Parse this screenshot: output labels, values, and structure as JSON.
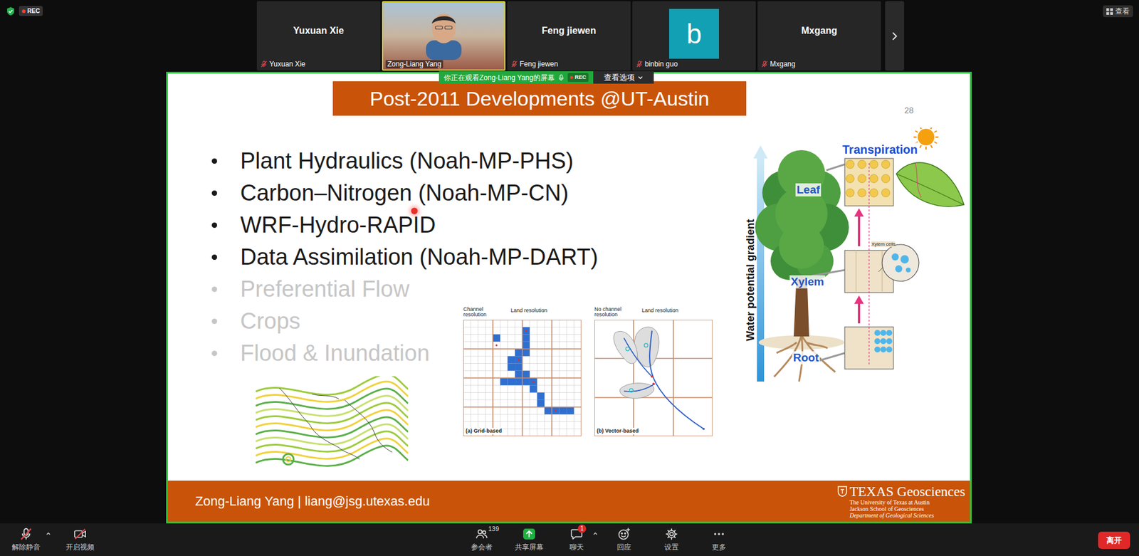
{
  "top_bar": {
    "recording": "REC",
    "view_button": "查看"
  },
  "participants": [
    {
      "kind": "name",
      "title": "Yuxuan Xie",
      "label": "Yuxuan Xie",
      "muted": true,
      "selected": false
    },
    {
      "kind": "video",
      "label": "Zong-Liang Yang",
      "selected": true
    },
    {
      "kind": "name",
      "title": "Feng jiewen",
      "label": "Feng jiewen",
      "muted": true,
      "selected": false
    },
    {
      "kind": "avatar",
      "avatar": "b",
      "label": "binbin guo",
      "muted": true,
      "selected": false
    },
    {
      "kind": "name",
      "title": "Mxgang",
      "label": "Mxgang",
      "muted": true,
      "selected": false
    }
  ],
  "share_banner": {
    "text": "你正在观看Zong-Liang Yang的屏幕",
    "rec": "REC",
    "options": "查看选项"
  },
  "slide": {
    "title": "Post-2011 Developments @UT-Austin",
    "page": "28",
    "bullets": [
      {
        "text": "Plant Hydraulics (Noah-MP-PHS)",
        "dimmed": false
      },
      {
        "text": "Carbon–Nitrogen (Noah-MP-CN)",
        "dimmed": false
      },
      {
        "text": "WRF-Hydro-RAPID",
        "dimmed": false
      },
      {
        "text": "Data Assimilation (Noah-MP-DART)",
        "dimmed": false
      },
      {
        "text": "Preferential Flow",
        "dimmed": true
      },
      {
        "text": "Crops",
        "dimmed": true
      },
      {
        "text": "Flood & Inundation",
        "dimmed": true
      }
    ],
    "grid_figure": {
      "channel_label": "Channel resolution",
      "land_label": "Land resolution",
      "caption": "(a) Grid-based"
    },
    "vector_figure": {
      "channel_label": "No channel resolution",
      "land_label": "Land resolution",
      "caption": "(b) Vector-based"
    },
    "tree_figure": {
      "axis": "Water potential gradient",
      "transpiration": "Transpiration",
      "leaf": "Leaf",
      "xylem": "Xylem",
      "root": "Root",
      "xylem_cells": "Xylem cells"
    },
    "footer": {
      "author_line": "Zong-Liang Yang | liang@jsg.utexas.edu",
      "logo": "TEXAS Geosciences",
      "logo_lines": [
        "The University of Texas at Austin",
        "Jackson School of Geosciences",
        "Department of Geological Sciences"
      ]
    }
  },
  "toolbar": {
    "left": [
      {
        "label": "解除静音",
        "off": true
      },
      {
        "label": "开启视频",
        "off": true
      }
    ],
    "center": [
      {
        "label": "参会者",
        "count": "139"
      },
      {
        "label": "共享屏幕"
      },
      {
        "label": "聊天",
        "badge": "1"
      },
      {
        "label": "回应"
      },
      {
        "label": "设置"
      },
      {
        "label": "更多"
      }
    ],
    "leave": "离开"
  }
}
